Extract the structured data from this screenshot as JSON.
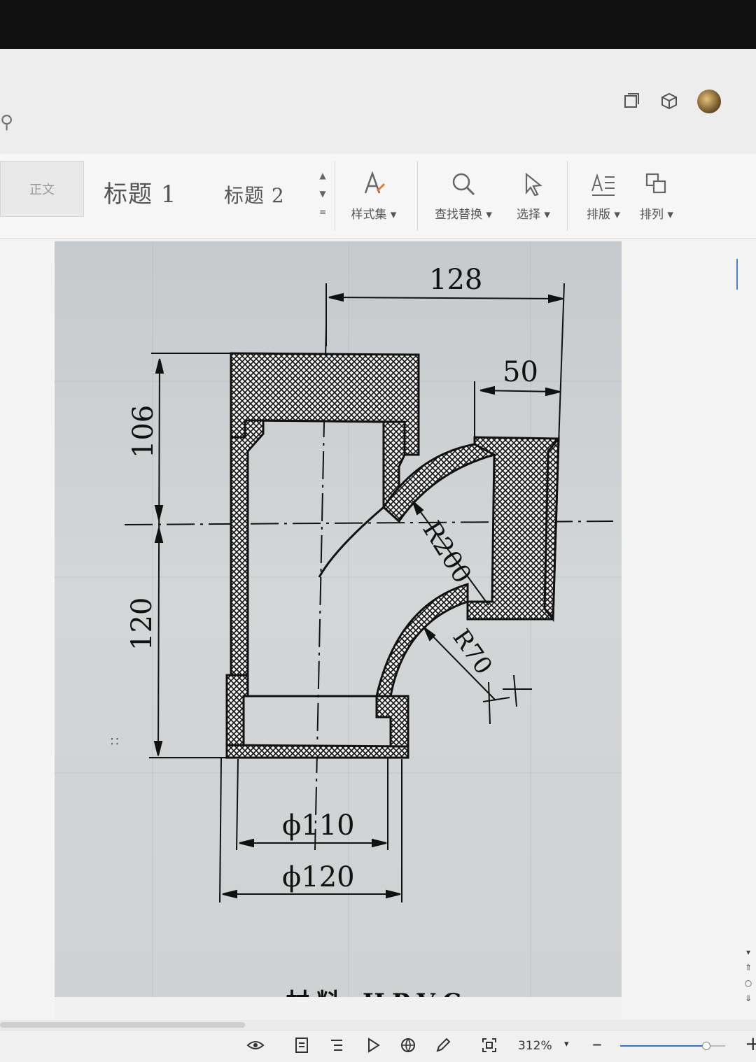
{
  "ribbon": {
    "style_normal": "正文",
    "style_heading1": "标题 1",
    "style_heading2": "标题 2",
    "tools": [
      {
        "label": "样式集",
        "icon": "style-set-icon"
      },
      {
        "label": "查找替换",
        "icon": "find-replace-icon"
      },
      {
        "label": "选择",
        "icon": "select-cursor-icon"
      },
      {
        "label": "排版",
        "icon": "typesetting-icon"
      },
      {
        "label": "排列",
        "icon": "arrange-icon"
      }
    ]
  },
  "drawing": {
    "dim_top": "128",
    "dim_branch": "50",
    "dim_upper": "106",
    "dim_lower": "120",
    "radius_large": "R200",
    "radius_small": "R70",
    "diameter_inner": "ϕ110",
    "diameter_outer": "ϕ120"
  },
  "document": {
    "caption": "材料 HPVC"
  },
  "statusbar": {
    "zoom": "312%",
    "zoom_level": 0.81
  },
  "colors": {
    "accent": "#2f6fd6",
    "drawing_line": "#111111"
  }
}
